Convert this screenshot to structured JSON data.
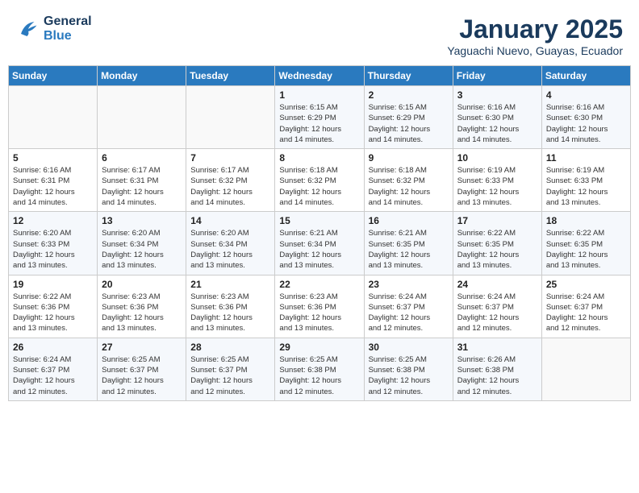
{
  "header": {
    "logo_line1": "General",
    "logo_line2": "Blue",
    "month": "January 2025",
    "location": "Yaguachi Nuevo, Guayas, Ecuador"
  },
  "weekdays": [
    "Sunday",
    "Monday",
    "Tuesday",
    "Wednesday",
    "Thursday",
    "Friday",
    "Saturday"
  ],
  "weeks": [
    [
      {
        "day": "",
        "info": ""
      },
      {
        "day": "",
        "info": ""
      },
      {
        "day": "",
        "info": ""
      },
      {
        "day": "1",
        "info": "Sunrise: 6:15 AM\nSunset: 6:29 PM\nDaylight: 12 hours\nand 14 minutes."
      },
      {
        "day": "2",
        "info": "Sunrise: 6:15 AM\nSunset: 6:29 PM\nDaylight: 12 hours\nand 14 minutes."
      },
      {
        "day": "3",
        "info": "Sunrise: 6:16 AM\nSunset: 6:30 PM\nDaylight: 12 hours\nand 14 minutes."
      },
      {
        "day": "4",
        "info": "Sunrise: 6:16 AM\nSunset: 6:30 PM\nDaylight: 12 hours\nand 14 minutes."
      }
    ],
    [
      {
        "day": "5",
        "info": "Sunrise: 6:16 AM\nSunset: 6:31 PM\nDaylight: 12 hours\nand 14 minutes."
      },
      {
        "day": "6",
        "info": "Sunrise: 6:17 AM\nSunset: 6:31 PM\nDaylight: 12 hours\nand 14 minutes."
      },
      {
        "day": "7",
        "info": "Sunrise: 6:17 AM\nSunset: 6:32 PM\nDaylight: 12 hours\nand 14 minutes."
      },
      {
        "day": "8",
        "info": "Sunrise: 6:18 AM\nSunset: 6:32 PM\nDaylight: 12 hours\nand 14 minutes."
      },
      {
        "day": "9",
        "info": "Sunrise: 6:18 AM\nSunset: 6:32 PM\nDaylight: 12 hours\nand 14 minutes."
      },
      {
        "day": "10",
        "info": "Sunrise: 6:19 AM\nSunset: 6:33 PM\nDaylight: 12 hours\nand 13 minutes."
      },
      {
        "day": "11",
        "info": "Sunrise: 6:19 AM\nSunset: 6:33 PM\nDaylight: 12 hours\nand 13 minutes."
      }
    ],
    [
      {
        "day": "12",
        "info": "Sunrise: 6:20 AM\nSunset: 6:33 PM\nDaylight: 12 hours\nand 13 minutes."
      },
      {
        "day": "13",
        "info": "Sunrise: 6:20 AM\nSunset: 6:34 PM\nDaylight: 12 hours\nand 13 minutes."
      },
      {
        "day": "14",
        "info": "Sunrise: 6:20 AM\nSunset: 6:34 PM\nDaylight: 12 hours\nand 13 minutes."
      },
      {
        "day": "15",
        "info": "Sunrise: 6:21 AM\nSunset: 6:34 PM\nDaylight: 12 hours\nand 13 minutes."
      },
      {
        "day": "16",
        "info": "Sunrise: 6:21 AM\nSunset: 6:35 PM\nDaylight: 12 hours\nand 13 minutes."
      },
      {
        "day": "17",
        "info": "Sunrise: 6:22 AM\nSunset: 6:35 PM\nDaylight: 12 hours\nand 13 minutes."
      },
      {
        "day": "18",
        "info": "Sunrise: 6:22 AM\nSunset: 6:35 PM\nDaylight: 12 hours\nand 13 minutes."
      }
    ],
    [
      {
        "day": "19",
        "info": "Sunrise: 6:22 AM\nSunset: 6:36 PM\nDaylight: 12 hours\nand 13 minutes."
      },
      {
        "day": "20",
        "info": "Sunrise: 6:23 AM\nSunset: 6:36 PM\nDaylight: 12 hours\nand 13 minutes."
      },
      {
        "day": "21",
        "info": "Sunrise: 6:23 AM\nSunset: 6:36 PM\nDaylight: 12 hours\nand 13 minutes."
      },
      {
        "day": "22",
        "info": "Sunrise: 6:23 AM\nSunset: 6:36 PM\nDaylight: 12 hours\nand 13 minutes."
      },
      {
        "day": "23",
        "info": "Sunrise: 6:24 AM\nSunset: 6:37 PM\nDaylight: 12 hours\nand 12 minutes."
      },
      {
        "day": "24",
        "info": "Sunrise: 6:24 AM\nSunset: 6:37 PM\nDaylight: 12 hours\nand 12 minutes."
      },
      {
        "day": "25",
        "info": "Sunrise: 6:24 AM\nSunset: 6:37 PM\nDaylight: 12 hours\nand 12 minutes."
      }
    ],
    [
      {
        "day": "26",
        "info": "Sunrise: 6:24 AM\nSunset: 6:37 PM\nDaylight: 12 hours\nand 12 minutes."
      },
      {
        "day": "27",
        "info": "Sunrise: 6:25 AM\nSunset: 6:37 PM\nDaylight: 12 hours\nand 12 minutes."
      },
      {
        "day": "28",
        "info": "Sunrise: 6:25 AM\nSunset: 6:37 PM\nDaylight: 12 hours\nand 12 minutes."
      },
      {
        "day": "29",
        "info": "Sunrise: 6:25 AM\nSunset: 6:38 PM\nDaylight: 12 hours\nand 12 minutes."
      },
      {
        "day": "30",
        "info": "Sunrise: 6:25 AM\nSunset: 6:38 PM\nDaylight: 12 hours\nand 12 minutes."
      },
      {
        "day": "31",
        "info": "Sunrise: 6:26 AM\nSunset: 6:38 PM\nDaylight: 12 hours\nand 12 minutes."
      },
      {
        "day": "",
        "info": ""
      }
    ]
  ]
}
